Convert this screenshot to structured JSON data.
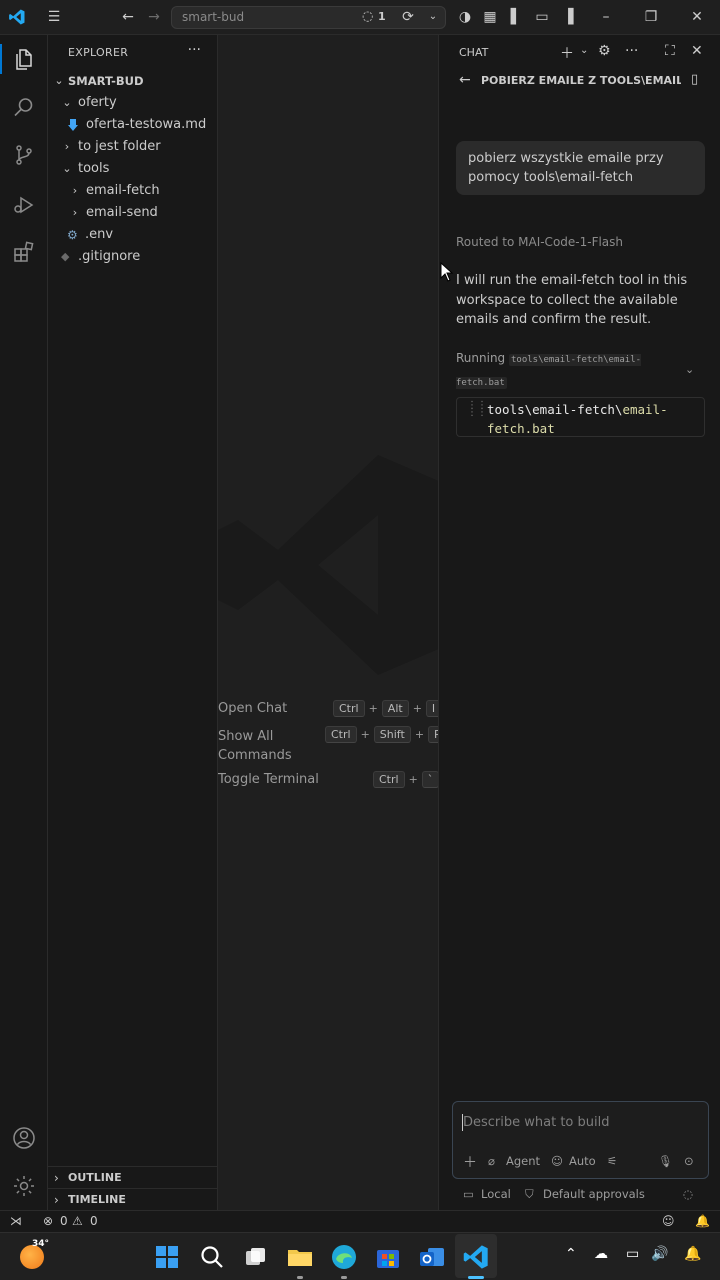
{
  "window": {
    "search_text": "smart-bud",
    "sync_count": "1"
  },
  "explorer": {
    "title": "EXPLORER",
    "root": "SMART-BUD",
    "items": [
      {
        "label": "oferty"
      },
      {
        "label": "oferta-testowa.md"
      },
      {
        "label": "to jest folder"
      },
      {
        "label": "tools"
      },
      {
        "label": "email-fetch"
      },
      {
        "label": "email-send"
      },
      {
        "label": ".env"
      },
      {
        "label": ".gitignore"
      }
    ],
    "outline": "OUTLINE",
    "timeline": "TIMELINE"
  },
  "editor": {
    "hints": [
      {
        "label": "Open Chat",
        "keys": [
          "Ctrl",
          "Alt",
          "I"
        ]
      },
      {
        "label": "Show All Commands",
        "keys": [
          "Ctrl",
          "Shift",
          "P"
        ]
      },
      {
        "label": "Toggle Terminal",
        "keys": [
          "Ctrl",
          "`"
        ]
      }
    ]
  },
  "chat": {
    "title": "CHAT",
    "conversation_title": "POBIERZ EMAILE Z TOOLS\\EMAIL-F...",
    "user_message": "pobierz wszystkie emaile przy pomocy tools\\email-fetch",
    "routed": "Routed to MAI-Code-1-Flash",
    "response": "I will run the email-fetch tool in this workspace to collect the available emails and confirm the result.",
    "running_label": "Running",
    "running_cmd": "tools\\email-fetch\\email-fetch.bat",
    "code_line1_plain": "tools\\email-fetch\\",
    "code_line1_acc": "email-",
    "code_line2_acc": "fetch.bat",
    "input_placeholder": "Describe what to build",
    "agent_label": "Agent",
    "auto_label": "Auto",
    "local_label": "Local",
    "approvals_label": "Default approvals"
  },
  "status": {
    "errors": "0",
    "warnings": "0"
  },
  "taskbar": {
    "weather_temp": "34°"
  },
  "colors": {
    "accent": "#0078d4",
    "vscode_blue": "#23a9f2"
  }
}
